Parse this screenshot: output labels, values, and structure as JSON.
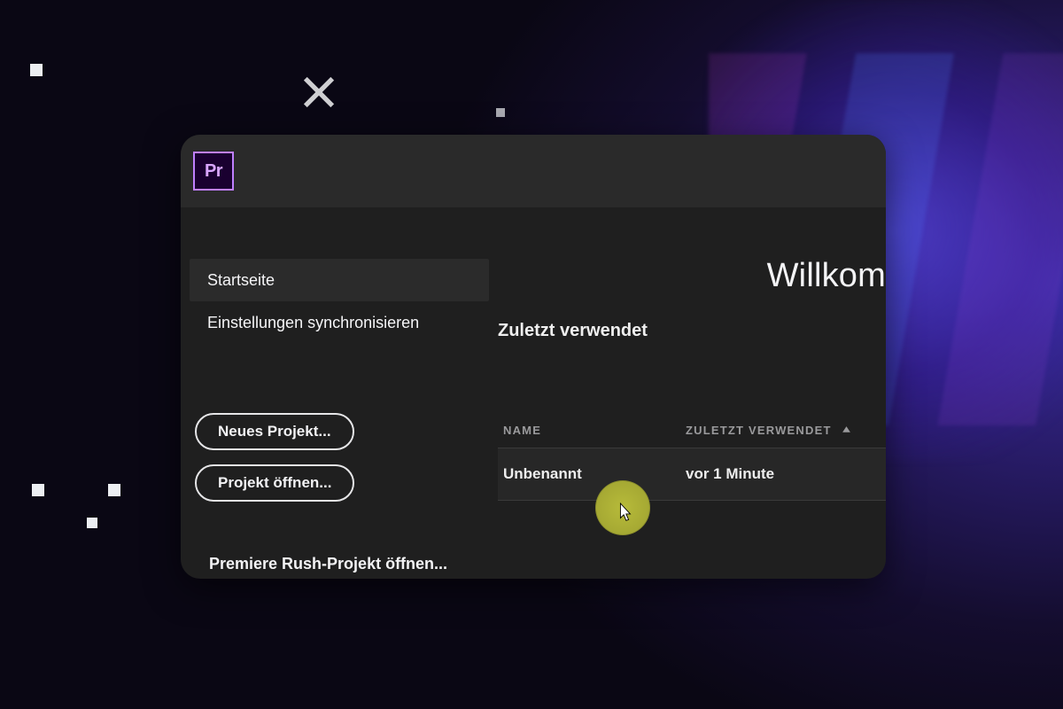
{
  "app": {
    "logo_text": "Pr",
    "welcome_title": "Willkom"
  },
  "sidebar": {
    "items": [
      {
        "label": "Startseite",
        "active": true
      },
      {
        "label": "Einstellungen synchronisieren",
        "active": false
      }
    ],
    "buttons": {
      "new_project": "Neues Projekt...",
      "open_project": "Projekt öffnen..."
    },
    "rush_link": "Premiere Rush-Projekt öffnen..."
  },
  "recent": {
    "heading": "Zuletzt verwendet",
    "columns": {
      "name": "NAME",
      "last_used": "ZULETZT VERWENDET"
    },
    "rows": [
      {
        "name": "Unbenannt",
        "last_used": "vor 1 Minute"
      }
    ]
  },
  "colors": {
    "accent_purple": "#c080ff",
    "panel_bg": "#1f1f1f",
    "header_bg": "#2a2a2a"
  }
}
